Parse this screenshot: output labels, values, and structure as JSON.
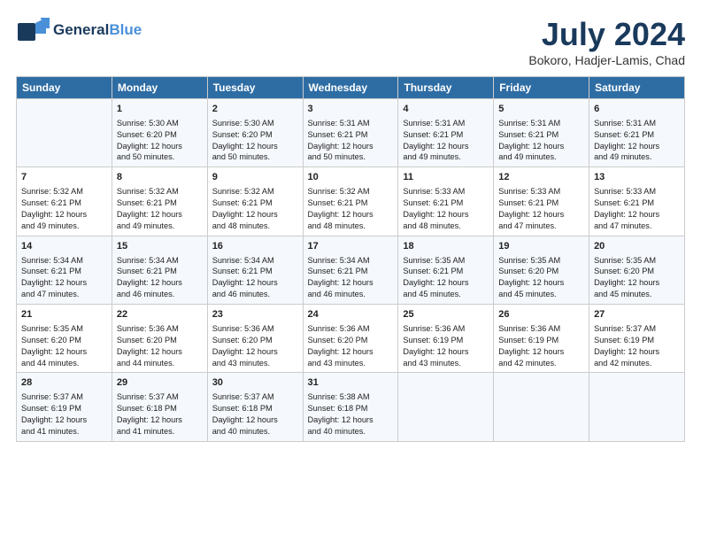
{
  "logo": {
    "line1": "General",
    "line2": "Blue"
  },
  "title": "July 2024",
  "subtitle": "Bokoro, Hadjer-Lamis, Chad",
  "days": [
    "Sunday",
    "Monday",
    "Tuesday",
    "Wednesday",
    "Thursday",
    "Friday",
    "Saturday"
  ],
  "weeks": [
    [
      {
        "day": "",
        "info": ""
      },
      {
        "day": "1",
        "info": "Sunrise: 5:30 AM\nSunset: 6:20 PM\nDaylight: 12 hours\nand 50 minutes."
      },
      {
        "day": "2",
        "info": "Sunrise: 5:30 AM\nSunset: 6:20 PM\nDaylight: 12 hours\nand 50 minutes."
      },
      {
        "day": "3",
        "info": "Sunrise: 5:31 AM\nSunset: 6:21 PM\nDaylight: 12 hours\nand 50 minutes."
      },
      {
        "day": "4",
        "info": "Sunrise: 5:31 AM\nSunset: 6:21 PM\nDaylight: 12 hours\nand 49 minutes."
      },
      {
        "day": "5",
        "info": "Sunrise: 5:31 AM\nSunset: 6:21 PM\nDaylight: 12 hours\nand 49 minutes."
      },
      {
        "day": "6",
        "info": "Sunrise: 5:31 AM\nSunset: 6:21 PM\nDaylight: 12 hours\nand 49 minutes."
      }
    ],
    [
      {
        "day": "7",
        "info": "Sunrise: 5:32 AM\nSunset: 6:21 PM\nDaylight: 12 hours\nand 49 minutes."
      },
      {
        "day": "8",
        "info": "Sunrise: 5:32 AM\nSunset: 6:21 PM\nDaylight: 12 hours\nand 49 minutes."
      },
      {
        "day": "9",
        "info": "Sunrise: 5:32 AM\nSunset: 6:21 PM\nDaylight: 12 hours\nand 48 minutes."
      },
      {
        "day": "10",
        "info": "Sunrise: 5:32 AM\nSunset: 6:21 PM\nDaylight: 12 hours\nand 48 minutes."
      },
      {
        "day": "11",
        "info": "Sunrise: 5:33 AM\nSunset: 6:21 PM\nDaylight: 12 hours\nand 48 minutes."
      },
      {
        "day": "12",
        "info": "Sunrise: 5:33 AM\nSunset: 6:21 PM\nDaylight: 12 hours\nand 47 minutes."
      },
      {
        "day": "13",
        "info": "Sunrise: 5:33 AM\nSunset: 6:21 PM\nDaylight: 12 hours\nand 47 minutes."
      }
    ],
    [
      {
        "day": "14",
        "info": "Sunrise: 5:34 AM\nSunset: 6:21 PM\nDaylight: 12 hours\nand 47 minutes."
      },
      {
        "day": "15",
        "info": "Sunrise: 5:34 AM\nSunset: 6:21 PM\nDaylight: 12 hours\nand 46 minutes."
      },
      {
        "day": "16",
        "info": "Sunrise: 5:34 AM\nSunset: 6:21 PM\nDaylight: 12 hours\nand 46 minutes."
      },
      {
        "day": "17",
        "info": "Sunrise: 5:34 AM\nSunset: 6:21 PM\nDaylight: 12 hours\nand 46 minutes."
      },
      {
        "day": "18",
        "info": "Sunrise: 5:35 AM\nSunset: 6:21 PM\nDaylight: 12 hours\nand 45 minutes."
      },
      {
        "day": "19",
        "info": "Sunrise: 5:35 AM\nSunset: 6:20 PM\nDaylight: 12 hours\nand 45 minutes."
      },
      {
        "day": "20",
        "info": "Sunrise: 5:35 AM\nSunset: 6:20 PM\nDaylight: 12 hours\nand 45 minutes."
      }
    ],
    [
      {
        "day": "21",
        "info": "Sunrise: 5:35 AM\nSunset: 6:20 PM\nDaylight: 12 hours\nand 44 minutes."
      },
      {
        "day": "22",
        "info": "Sunrise: 5:36 AM\nSunset: 6:20 PM\nDaylight: 12 hours\nand 44 minutes."
      },
      {
        "day": "23",
        "info": "Sunrise: 5:36 AM\nSunset: 6:20 PM\nDaylight: 12 hours\nand 43 minutes."
      },
      {
        "day": "24",
        "info": "Sunrise: 5:36 AM\nSunset: 6:20 PM\nDaylight: 12 hours\nand 43 minutes."
      },
      {
        "day": "25",
        "info": "Sunrise: 5:36 AM\nSunset: 6:19 PM\nDaylight: 12 hours\nand 43 minutes."
      },
      {
        "day": "26",
        "info": "Sunrise: 5:36 AM\nSunset: 6:19 PM\nDaylight: 12 hours\nand 42 minutes."
      },
      {
        "day": "27",
        "info": "Sunrise: 5:37 AM\nSunset: 6:19 PM\nDaylight: 12 hours\nand 42 minutes."
      }
    ],
    [
      {
        "day": "28",
        "info": "Sunrise: 5:37 AM\nSunset: 6:19 PM\nDaylight: 12 hours\nand 41 minutes."
      },
      {
        "day": "29",
        "info": "Sunrise: 5:37 AM\nSunset: 6:18 PM\nDaylight: 12 hours\nand 41 minutes."
      },
      {
        "day": "30",
        "info": "Sunrise: 5:37 AM\nSunset: 6:18 PM\nDaylight: 12 hours\nand 40 minutes."
      },
      {
        "day": "31",
        "info": "Sunrise: 5:38 AM\nSunset: 6:18 PM\nDaylight: 12 hours\nand 40 minutes."
      },
      {
        "day": "",
        "info": ""
      },
      {
        "day": "",
        "info": ""
      },
      {
        "day": "",
        "info": ""
      }
    ]
  ]
}
